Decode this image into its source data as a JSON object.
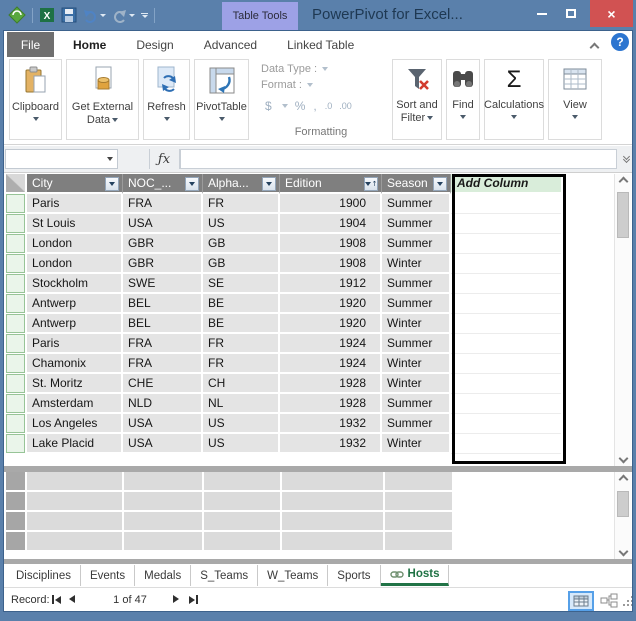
{
  "window": {
    "title": "PowerPivot for Excel...",
    "contextual_tab": "Table Tools"
  },
  "ribbon": {
    "tabs": [
      "File",
      "Home",
      "Design",
      "Advanced",
      "Linked Table"
    ],
    "active_tab": "Home",
    "buttons": {
      "clipboard": "Clipboard",
      "get_external_data": "Get External Data",
      "refresh": "Refresh",
      "pivottable": "PivotTable",
      "sort_and_filter": "Sort and Filter",
      "find": "Find",
      "calculations": "Calculations",
      "view": "View"
    },
    "formatting": {
      "data_type_label": "Data Type :",
      "format_label": "Format :",
      "group_label": "Formatting",
      "icon_glyphs": {
        "currency": "$",
        "percent": "%",
        "thousands": ",",
        "more_decimals": ".0",
        "fewer_decimals": ".00"
      }
    }
  },
  "formula_bar": {
    "fx": "ƒx",
    "name_box_value": "",
    "formula_value": ""
  },
  "grid": {
    "columns": [
      {
        "label": "City"
      },
      {
        "label": "NOC_..."
      },
      {
        "label": "Alpha..."
      },
      {
        "label": "Edition",
        "sorted": true
      },
      {
        "label": "Season"
      }
    ],
    "add_column_label": "Add Column",
    "rows": [
      [
        "Paris",
        "FRA",
        "FR",
        "1900",
        "Summer"
      ],
      [
        "St Louis",
        "USA",
        "US",
        "1904",
        "Summer"
      ],
      [
        "London",
        "GBR",
        "GB",
        "1908",
        "Summer"
      ],
      [
        "London",
        "GBR",
        "GB",
        "1908",
        "Winter"
      ],
      [
        "Stockholm",
        "SWE",
        "SE",
        "1912",
        "Summer"
      ],
      [
        "Antwerp",
        "BEL",
        "BE",
        "1920",
        "Summer"
      ],
      [
        "Antwerp",
        "BEL",
        "BE",
        "1920",
        "Winter"
      ],
      [
        "Paris",
        "FRA",
        "FR",
        "1924",
        "Summer"
      ],
      [
        "Chamonix",
        "FRA",
        "FR",
        "1924",
        "Winter"
      ],
      [
        "St. Moritz",
        "CHE",
        "CH",
        "1928",
        "Winter"
      ],
      [
        "Amsterdam",
        "NLD",
        "NL",
        "1928",
        "Summer"
      ],
      [
        "Los Angeles",
        "USA",
        "US",
        "1932",
        "Summer"
      ],
      [
        "Lake Placid",
        "USA",
        "US",
        "1932",
        "Winter"
      ]
    ]
  },
  "sheets": {
    "tabs": [
      "Disciplines",
      "Events",
      "Medals",
      "S_Teams",
      "W_Teams",
      "Sports",
      "Hosts"
    ],
    "active_tab": "Hosts"
  },
  "statusbar": {
    "record_label": "Record:",
    "record_position": "1 of 47"
  },
  "icons": {
    "help": "?",
    "close": "×",
    "sigma": "Σ",
    "sort_ascending_mark": "↑"
  },
  "colors": {
    "titlebar": "#5a80ab",
    "contextual_tab": "#9da1e6",
    "close_button": "#d15252",
    "grid_header": "#7f7f7f",
    "add_column_header_bg": "#d9edda",
    "active_sheet_green": "#217346",
    "selection_border": "#000000"
  }
}
